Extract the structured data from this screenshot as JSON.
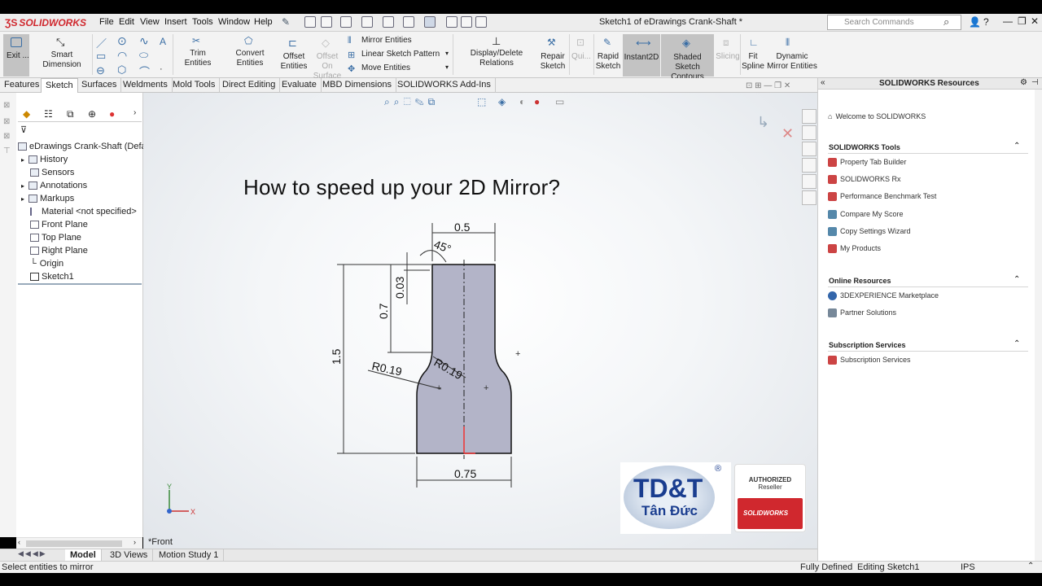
{
  "app": {
    "logo": "SOLIDWORKS",
    "menu": [
      "File",
      "Edit",
      "View",
      "Insert",
      "Tools",
      "Window",
      "Help"
    ],
    "window_title": "Sketch1 of eDrawings Crank-Shaft *",
    "search_placeholder": "Search Commands"
  },
  "commands": {
    "exit": "Exit ...",
    "smart_dimension": "Smart Dimension",
    "trim": "Trim Entities",
    "convert": "Convert Entities",
    "offset": "Offset Entities",
    "offset_surface": "Offset On Surface",
    "mirror": "Mirror Entities",
    "linear_pattern": "Linear Sketch Pattern",
    "move": "Move Entities",
    "display_relations": "Display/Delete Relations",
    "repair": "Repair Sketch",
    "quick": "Qui...",
    "rapid": "Rapid Sketch",
    "instant2d": "Instant2D",
    "shaded": "Shaded Sketch Contours",
    "slicing": "Slicing",
    "fit_spline": "Fit Spline",
    "dynamic_mirror": "Dynamic Mirror Entities"
  },
  "tabs": [
    "Features",
    "Sketch",
    "Surfaces",
    "Weldments",
    "Mold Tools",
    "Direct Editing",
    "Evaluate",
    "MBD Dimensions",
    "SOLIDWORKS Add-Ins"
  ],
  "active_tab": "Sketch",
  "tree": {
    "root": "eDrawings Crank-Shaft  (Defau",
    "items": [
      "History",
      "Sensors",
      "Annotations",
      "Markups",
      "Material <not specified>",
      "Front Plane",
      "Top Plane",
      "Right Plane",
      "Origin",
      "Sketch1"
    ]
  },
  "viewport": {
    "headline": "How to speed up your 2D Mirror?",
    "view_label": "*Front",
    "triad": {
      "x": "X",
      "y": "Y"
    }
  },
  "dimensions": {
    "top_width": "0.5",
    "angle": "45°",
    "chamfer": "0.03",
    "neck": "0.7",
    "height": "1.5",
    "r_left": "R0.19",
    "r_right": "R0.19",
    "bottom_width": "0.75"
  },
  "logos": {
    "tdt_main": "TD&T",
    "tdt_sub": "Tân Đức",
    "authorized": "AUTHORIZED",
    "reseller": "Reseller",
    "sw": "SOLIDWORKS"
  },
  "resources": {
    "title": "SOLIDWORKS Resources",
    "welcome": "Welcome to SOLIDWORKS",
    "sections": [
      {
        "title": "SOLIDWORKS Tools",
        "items": [
          "Property Tab Builder",
          "SOLIDWORKS Rx",
          "Performance Benchmark Test",
          "Compare My Score",
          "Copy Settings Wizard",
          "My Products"
        ]
      },
      {
        "title": "Online Resources",
        "items": [
          "3DEXPERIENCE Marketplace",
          "Partner Solutions"
        ]
      },
      {
        "title": "Subscription Services",
        "items": [
          "Subscription Services"
        ]
      }
    ]
  },
  "bottom_tabs": [
    "Model",
    "3D Views",
    "Motion Study 1"
  ],
  "status": {
    "message": "Select entities to mirror",
    "defined": "Fully Defined",
    "editing": "Editing Sketch1",
    "units": "IPS"
  },
  "colors": {
    "accent": "#d0282e",
    "sketch_fill": "#b3b4c8",
    "pressed": "#c3c3c3"
  }
}
